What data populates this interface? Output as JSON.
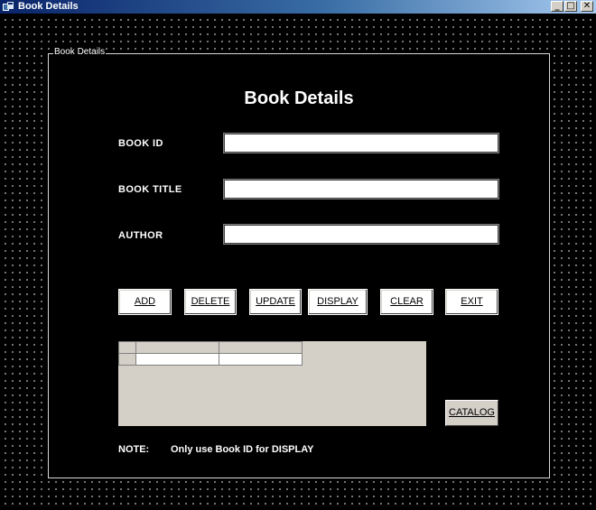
{
  "window": {
    "title": "Book Details",
    "controls": {
      "minimize": "_",
      "maximize": "□",
      "close": "✕"
    },
    "icon": "app-icon"
  },
  "frame": {
    "caption": "Book Details"
  },
  "form": {
    "heading": "Book Details",
    "fields": [
      {
        "label": "BOOK ID",
        "value": ""
      },
      {
        "label": "BOOK TITLE",
        "value": ""
      },
      {
        "label": "AUTHOR",
        "value": ""
      }
    ]
  },
  "buttons": {
    "add": "ADD",
    "delete": "DELETE",
    "update": "UPDATE",
    "display": "DISPLAY",
    "clear": "CLEAR",
    "exit": "EXIT",
    "catalog": "CATALOG"
  },
  "grid": {
    "columns": [
      "",
      ""
    ],
    "rows": [
      [
        "",
        ""
      ]
    ]
  },
  "note": {
    "label": "NOTE:",
    "text": "Only use Book ID for DISPLAY"
  },
  "colors": {
    "background": "#000000",
    "text": "#ffffff",
    "grid_bg": "#d4d0c8",
    "titlebar_start": "#0a246a",
    "titlebar_end": "#a6caf0"
  }
}
